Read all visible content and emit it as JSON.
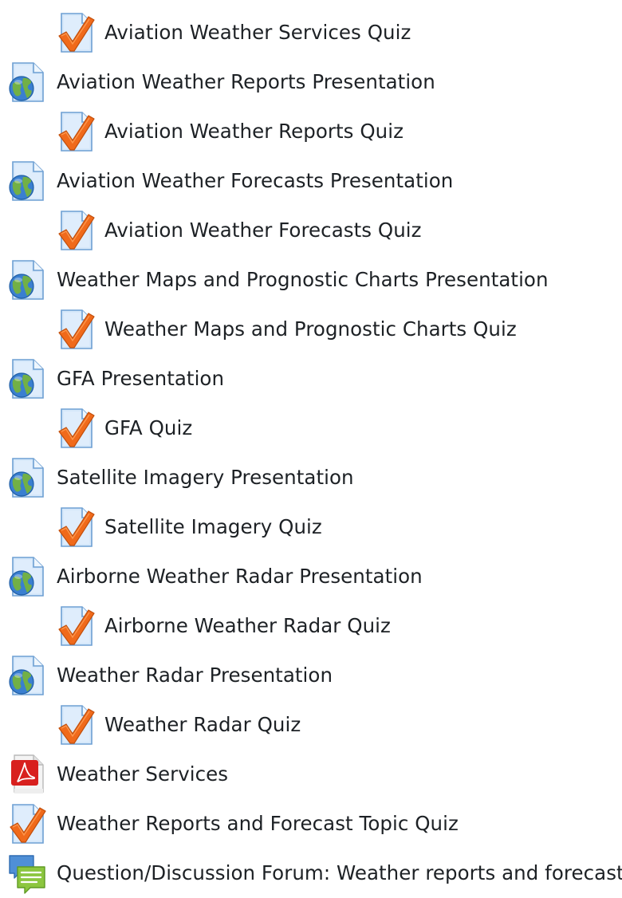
{
  "activities": [
    {
      "type": "quiz",
      "icon": "quiz-icon",
      "indent": 1,
      "label": "Aviation Weather Services Quiz"
    },
    {
      "type": "page",
      "icon": "presentation-icon",
      "indent": 0,
      "label": "Aviation Weather Reports Presentation"
    },
    {
      "type": "quiz",
      "icon": "quiz-icon",
      "indent": 1,
      "label": "Aviation Weather Reports Quiz"
    },
    {
      "type": "page",
      "icon": "presentation-icon",
      "indent": 0,
      "label": "Aviation Weather Forecasts Presentation"
    },
    {
      "type": "quiz",
      "icon": "quiz-icon",
      "indent": 1,
      "label": "Aviation Weather Forecasts Quiz"
    },
    {
      "type": "page",
      "icon": "presentation-icon",
      "indent": 0,
      "label": "Weather Maps and Prognostic Charts Presentation"
    },
    {
      "type": "quiz",
      "icon": "quiz-icon",
      "indent": 1,
      "label": "Weather Maps and Prognostic Charts Quiz"
    },
    {
      "type": "page",
      "icon": "presentation-icon",
      "indent": 0,
      "label": "GFA Presentation"
    },
    {
      "type": "quiz",
      "icon": "quiz-icon",
      "indent": 1,
      "label": "GFA Quiz"
    },
    {
      "type": "page",
      "icon": "presentation-icon",
      "indent": 0,
      "label": "Satellite Imagery Presentation"
    },
    {
      "type": "quiz",
      "icon": "quiz-icon",
      "indent": 1,
      "label": "Satellite Imagery Quiz"
    },
    {
      "type": "page",
      "icon": "presentation-icon",
      "indent": 0,
      "label": "Airborne Weather Radar Presentation"
    },
    {
      "type": "quiz",
      "icon": "quiz-icon",
      "indent": 1,
      "label": "Airborne Weather Radar Quiz"
    },
    {
      "type": "page",
      "icon": "presentation-icon",
      "indent": 0,
      "label": "Weather Radar Presentation"
    },
    {
      "type": "quiz",
      "icon": "quiz-icon",
      "indent": 1,
      "label": "Weather Radar Quiz"
    },
    {
      "type": "pdf",
      "icon": "pdf-icon",
      "indent": 0,
      "label": "Weather Services"
    },
    {
      "type": "quiz",
      "icon": "quiz-icon",
      "indent": 0,
      "label": "Weather Reports and Forecast Topic Quiz"
    },
    {
      "type": "forum",
      "icon": "forum-icon",
      "indent": 0,
      "label": "Question/Discussion Forum: Weather reports and forecast"
    }
  ],
  "colors": {
    "text": "#1d2125",
    "doc_blue": "#cfe3f7",
    "doc_border": "#6d9fd3",
    "check_orange": "#f06a1b",
    "globe_blue": "#3a7fd0",
    "globe_green": "#72b046",
    "pdf_red": "#d8201e",
    "forum_green": "#8cc63f"
  }
}
